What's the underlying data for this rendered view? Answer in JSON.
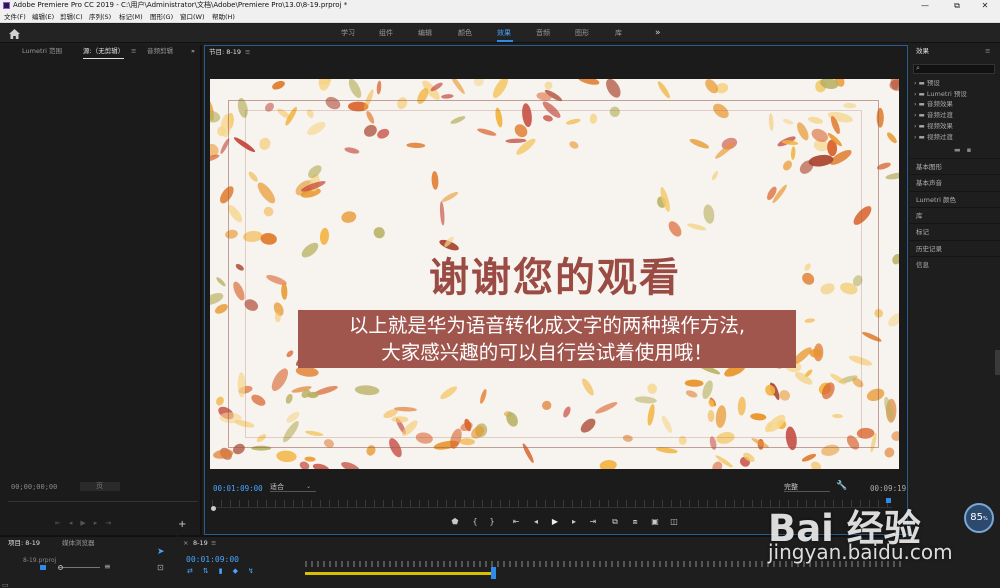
{
  "titlebar": {
    "title": "Adobe Premiere Pro CC 2019 - C:\\用户\\Administrator\\文档\\Adobe\\Premiere Pro\\13.0\\8-19.prproj *",
    "minimize": "—",
    "maximize": "⧉",
    "close": "✕"
  },
  "menubar": [
    "文件(F)",
    "编辑(E)",
    "剪辑(C)",
    "序列(S)",
    "标记(M)",
    "图形(G)",
    "窗口(W)",
    "帮助(H)"
  ],
  "workspaces": {
    "items": [
      "学习",
      "组件",
      "编辑",
      "颜色",
      "效果",
      "音频",
      "图形",
      "库"
    ],
    "active": "效果",
    "more": "»"
  },
  "source_panel": {
    "tabs": [
      "Lumetri 范围",
      "源:（无剪辑）",
      "音频剪辑"
    ],
    "more": "»",
    "timecode": "00;00;00;00",
    "page": "页"
  },
  "program_panel": {
    "tab": "节目: 8-19",
    "menu": "≡",
    "timecode": "00:01:09:00",
    "fit": "适合",
    "quality": "完整",
    "duration": "00:09:19"
  },
  "video": {
    "title": "谢谢您的观看",
    "subtitle_line1": "以上就是华为语音转化成文字的两种操作方法,",
    "subtitle_line2": "大家感兴趣的可以自行尝试着使用哦！"
  },
  "effects_panel": {
    "tab": "效果",
    "menu": "≡",
    "tree": [
      "预设",
      "Lumetri 预设",
      "音频效果",
      "音频过渡",
      "视频效果",
      "视频过渡"
    ],
    "sections": [
      "基本图形",
      "基本声音",
      "Lumetri 颜色",
      "库",
      "标记",
      "历史记录",
      "信息"
    ]
  },
  "project_panel": {
    "tab": "项目: 8-19",
    "tab2": "媒体浏览器",
    "file": "8-19.prproj"
  },
  "timeline": {
    "tab": "8-19",
    "timecode": "00:01:09:00"
  },
  "watermark": {
    "text": "Bai 经验",
    "url": "jingyan.baidu.com",
    "badge": "85",
    "badge_unit": "%"
  },
  "colors": {
    "accent": "#2d8ceb",
    "title_text": "#9a4b44",
    "subtitle_bg": "#a0554d",
    "video_bg": "#f7f3ee"
  }
}
